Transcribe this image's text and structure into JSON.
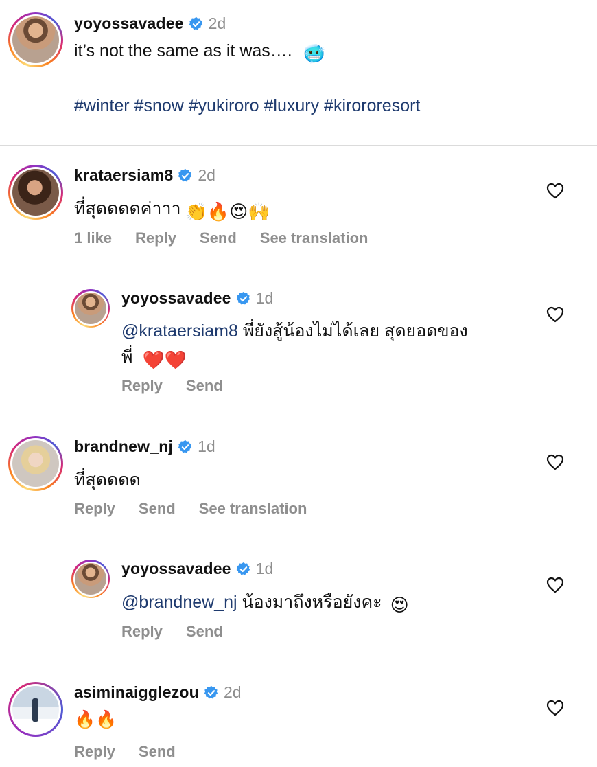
{
  "caption": {
    "username": "yoyossavadee",
    "time": "2d",
    "text": "it’s not the same as it was….",
    "emoji": "🥶",
    "hashtags": "#winter #snow #yukiroro #luxury #kirororesort"
  },
  "comments": [
    {
      "username": "krataersiam8",
      "time": "2d",
      "text": "ที่สุดดดดค่าาา",
      "emoji": "👏🔥😍🙌",
      "likes": "1 like",
      "reply": "Reply",
      "send": "Send",
      "translate": "See translation"
    },
    {
      "username": "yoyossavadee",
      "time": "1d",
      "mention": "@krataersiam8",
      "text_line1": "พี่ยังสู้น้องไม่ได้เลย สุดยอดของ",
      "text_line2": "พี่",
      "emoji": "❤️❤️",
      "reply": "Reply",
      "send": "Send"
    },
    {
      "username": "brandnew_nj",
      "time": "1d",
      "text": "ที่สุดดดด",
      "reply": "Reply",
      "send": "Send",
      "translate": "See translation"
    },
    {
      "username": "yoyossavadee",
      "time": "1d",
      "mention": "@brandnew_nj",
      "text": "น้องมาถึงหรือยังคะ",
      "emoji": "😍",
      "reply": "Reply",
      "send": "Send"
    },
    {
      "username": "asiminaigglezou",
      "time": "2d",
      "emoji": "🔥🔥",
      "reply": "Reply",
      "send": "Send"
    }
  ],
  "icons": {
    "verified": "verified-badge-icon",
    "like": "heart-outline-icon"
  },
  "colors": {
    "verified": "#3897f0",
    "mention": "#1e3a6e",
    "muted": "#8e8e8e"
  }
}
